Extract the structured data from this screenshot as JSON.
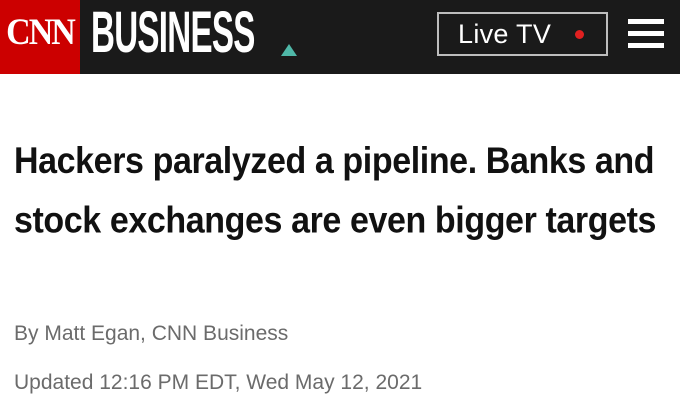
{
  "header": {
    "logo_text": "CNN",
    "section_title": "BUSINESS",
    "live_tv_label": "Live TV",
    "menu_icon": "hamburger-menu-icon",
    "colors": {
      "bar": "#1a1a1a",
      "logo": "#cc0000",
      "accent": "#4fb8a8",
      "live_dot": "#e02020"
    }
  },
  "article": {
    "headline": "Hackers paralyzed a pipeline. Banks and stock exchanges are even bigger targets",
    "byline": "By Matt Egan, CNN Business",
    "updated": "Updated 12:16 PM EDT, Wed May 12, 2021"
  }
}
